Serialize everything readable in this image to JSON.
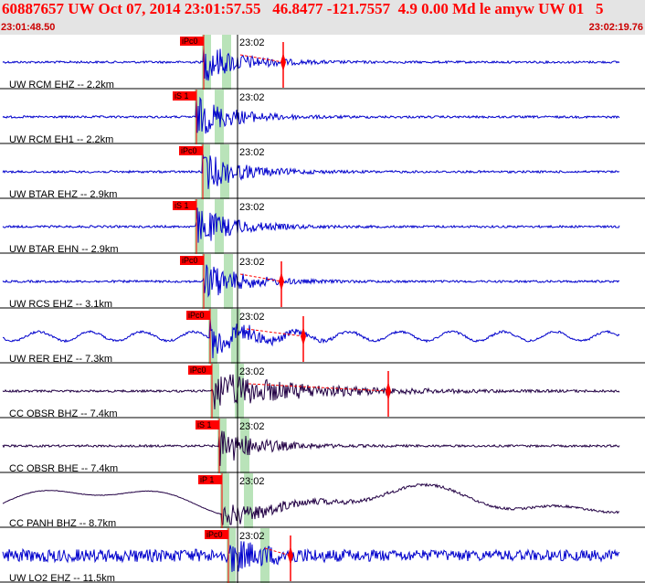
{
  "header": {
    "title": "60887657 UW Oct 07, 2014 23:01:57.55   46.8477 -121.7557  4.9 0.00 Md le amyw UW 01   5",
    "time_start": "23:01:48.50",
    "time_end": "23:02:19.76"
  },
  "colors": {
    "header_bg": "#e4e4e4",
    "header_text": "#ff0000",
    "trace_blue": "#0000cc",
    "trace_dark": "#220044",
    "pick": "#ff0000",
    "window": "#b9e3b9",
    "separator": "#000000"
  },
  "chart_data": {
    "type": "seismogram",
    "x_range": [
      "23:01:48.50",
      "23:02:19.76"
    ],
    "minute_tick_label": "23:02",
    "traces": [
      {
        "label": "UW RCM EHZ -- 2.2km",
        "pick": "iPc0",
        "color": "blue"
      },
      {
        "label": "UW RCM EH1 -- 2.2km",
        "pick": "iS 1",
        "color": "blue"
      },
      {
        "label": "UW BTAR EHZ -- 2.9km",
        "pick": "iPc0",
        "color": "blue"
      },
      {
        "label": "UW BTAR EHN -- 2.9km",
        "pick": "iS 1",
        "color": "blue"
      },
      {
        "label": "UW RCS EHZ -- 3.1km",
        "pick": "iPc0",
        "color": "blue"
      },
      {
        "label": "UW RER EHZ -- 7.3km",
        "pick": "iPc0",
        "color": "blue"
      },
      {
        "label": "CC OBSR BHZ -- 7.4km",
        "pick": "iPc0",
        "color": "dark"
      },
      {
        "label": "CC OBSR BHE -- 7.4km",
        "pick": "iS 1",
        "color": "dark"
      },
      {
        "label": "CC PANH BHZ -- 8.7km",
        "pick": "iP 1",
        "color": "dark"
      },
      {
        "label": "UW LO2 EHZ -- 11.5km",
        "pick": "iPc0",
        "color": "blue"
      }
    ]
  }
}
